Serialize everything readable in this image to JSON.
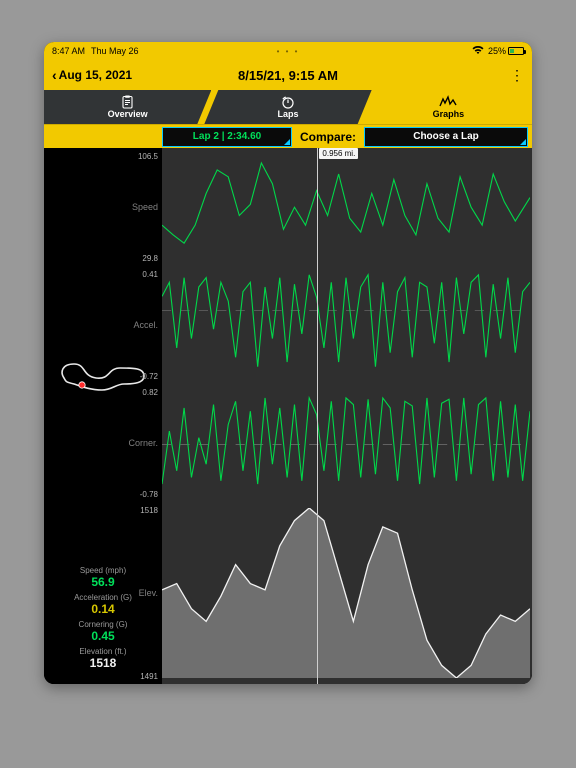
{
  "status": {
    "time": "8:47 AM",
    "date": "Thu May 26",
    "battery_pct": "25%"
  },
  "header": {
    "back_label": "Aug 15, 2021",
    "title": "8/15/21, 9:15 AM"
  },
  "tabs": {
    "overview": "Overview",
    "laps": "Laps",
    "graphs": "Graphs"
  },
  "filter": {
    "lap_selected": "Lap 2 | 2:34.60",
    "compare_label": "Compare:",
    "compare_selected": "Choose a Lap"
  },
  "cursor": {
    "distance": "0.956 mi."
  },
  "stats": {
    "speed_label": "Speed (mph)",
    "speed_value": "56.9",
    "accel_label": "Acceleration (G)",
    "accel_value": "0.14",
    "corner_label": "Cornering (G)",
    "corner_value": "0.45",
    "elev_label": "Elevation (ft.)",
    "elev_value": "1518"
  },
  "chart_data": [
    {
      "type": "line",
      "title": "Speed",
      "ylabel": "Speed",
      "ylim": [
        29.8,
        106.5
      ],
      "yticks": [
        29.8,
        106.5
      ],
      "x": [
        0,
        0.03,
        0.06,
        0.09,
        0.12,
        0.15,
        0.18,
        0.21,
        0.24,
        0.27,
        0.3,
        0.33,
        0.36,
        0.39,
        0.42,
        0.45,
        0.48,
        0.51,
        0.54,
        0.57,
        0.6,
        0.63,
        0.66,
        0.69,
        0.72,
        0.75,
        0.78,
        0.81,
        0.84,
        0.87,
        0.9,
        0.93,
        0.96,
        1.0
      ],
      "values": [
        55,
        48,
        42,
        55,
        78,
        95,
        90,
        62,
        70,
        100,
        85,
        52,
        68,
        55,
        80,
        62,
        92,
        60,
        50,
        78,
        55,
        88,
        62,
        48,
        85,
        60,
        50,
        90,
        68,
        55,
        92,
        72,
        58,
        75
      ]
    },
    {
      "type": "line",
      "title": "Accel.",
      "ylabel": "Accel.",
      "ylim": [
        -0.72,
        0.41
      ],
      "yticks": [
        -0.72,
        0.41
      ],
      "x": [
        0,
        0.02,
        0.04,
        0.06,
        0.08,
        0.1,
        0.12,
        0.14,
        0.16,
        0.18,
        0.2,
        0.22,
        0.24,
        0.26,
        0.28,
        0.3,
        0.32,
        0.34,
        0.36,
        0.38,
        0.4,
        0.42,
        0.44,
        0.46,
        0.48,
        0.5,
        0.52,
        0.54,
        0.56,
        0.58,
        0.6,
        0.62,
        0.64,
        0.66,
        0.68,
        0.7,
        0.72,
        0.74,
        0.76,
        0.78,
        0.8,
        0.82,
        0.84,
        0.86,
        0.88,
        0.9,
        0.92,
        0.94,
        0.96,
        0.98,
        1.0
      ],
      "values": [
        0.15,
        0.3,
        -0.4,
        0.35,
        -0.3,
        0.25,
        0.35,
        -0.2,
        0.3,
        0.1,
        -0.5,
        0.2,
        0.3,
        -0.6,
        0.25,
        -0.3,
        0.35,
        -0.55,
        0.28,
        -0.25,
        0.38,
        0.14,
        -0.4,
        0.3,
        -0.55,
        0.35,
        -0.3,
        0.25,
        0.38,
        -0.6,
        0.3,
        -0.45,
        0.2,
        0.35,
        -0.5,
        0.3,
        0.25,
        -0.35,
        0.3,
        -0.55,
        0.35,
        -0.25,
        0.3,
        0.38,
        -0.5,
        0.28,
        -0.3,
        0.35,
        -0.45,
        0.2,
        0.3
      ]
    },
    {
      "type": "line",
      "title": "Corner.",
      "ylabel": "Corner.",
      "ylim": [
        -0.78,
        0.82
      ],
      "yticks": [
        -0.78,
        0.82
      ],
      "x": [
        0,
        0.02,
        0.04,
        0.06,
        0.08,
        0.1,
        0.12,
        0.14,
        0.16,
        0.18,
        0.2,
        0.22,
        0.24,
        0.26,
        0.28,
        0.3,
        0.32,
        0.34,
        0.36,
        0.38,
        0.4,
        0.42,
        0.44,
        0.46,
        0.48,
        0.5,
        0.52,
        0.54,
        0.56,
        0.58,
        0.6,
        0.62,
        0.64,
        0.66,
        0.68,
        0.7,
        0.72,
        0.74,
        0.76,
        0.78,
        0.8,
        0.82,
        0.84,
        0.86,
        0.88,
        0.9,
        0.92,
        0.94,
        0.96,
        0.98,
        1.0
      ],
      "values": [
        -0.6,
        0.2,
        -0.4,
        0.55,
        -0.5,
        0.1,
        -0.3,
        0.6,
        -0.55,
        0.3,
        0.65,
        -0.4,
        0.5,
        -0.6,
        0.7,
        -0.3,
        0.55,
        -0.5,
        0.6,
        -0.55,
        0.7,
        0.45,
        -0.4,
        0.65,
        -0.55,
        0.7,
        0.6,
        -0.5,
        0.68,
        -0.45,
        0.7,
        0.55,
        -0.55,
        0.65,
        0.58,
        -0.6,
        0.7,
        -0.5,
        0.62,
        0.68,
        -0.55,
        0.7,
        -0.45,
        0.6,
        0.7,
        -0.55,
        0.65,
        -0.5,
        0.6,
        -0.55,
        0.5
      ]
    },
    {
      "type": "area",
      "title": "Elev.",
      "ylabel": "Elev.",
      "ylim": [
        1491,
        1518
      ],
      "yticks": [
        1491,
        1518
      ],
      "x": [
        0,
        0.04,
        0.08,
        0.12,
        0.16,
        0.2,
        0.24,
        0.28,
        0.32,
        0.36,
        0.4,
        0.44,
        0.48,
        0.52,
        0.56,
        0.6,
        0.64,
        0.68,
        0.72,
        0.76,
        0.8,
        0.84,
        0.88,
        0.92,
        0.96,
        1.0
      ],
      "values": [
        1505,
        1506,
        1502,
        1500,
        1504,
        1509,
        1506,
        1505,
        1512,
        1516,
        1518,
        1516,
        1508,
        1500,
        1509,
        1515,
        1514,
        1505,
        1497,
        1493,
        1491,
        1493,
        1498,
        1501,
        1500,
        1502
      ]
    }
  ]
}
